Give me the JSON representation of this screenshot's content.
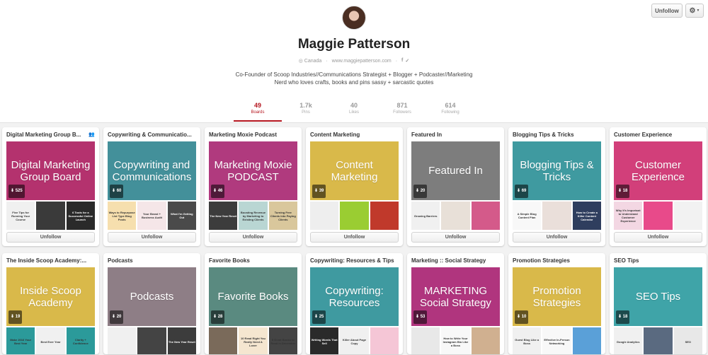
{
  "top_actions": {
    "unfollow_label": "Unfollow",
    "gear_icon": "gear-icon"
  },
  "profile": {
    "name": "Maggie Patterson",
    "location": "Canada",
    "website": "www.maggiepatterson.com",
    "bio_line1": "Co-Founder of Scoop Industries//Communications Strategist + Blogger + Podcaster//Marketing",
    "bio_line2": "Nerd who loves crafts, books and pins sassy + sarcastic quotes"
  },
  "stats": [
    {
      "num": "49",
      "label": "Boards",
      "active": true
    },
    {
      "num": "1.7k",
      "label": "Pins"
    },
    {
      "num": "40",
      "label": "Likes"
    },
    {
      "num": "871",
      "label": "Followers"
    },
    {
      "num": "614",
      "label": "Following"
    }
  ],
  "colors": {
    "accent": "#b5161f",
    "muted": "#999999"
  },
  "boards": [
    {
      "title": "Digital Marketing Group B...",
      "cover": "Digital Marketing Group Board",
      "pins": "525",
      "bg": "#b4326e",
      "button": "Unfollow",
      "collab": true,
      "thumbs": [
        {
          "t": "Five Tips for Running Your Course",
          "bg": "#f0f0f0"
        },
        {
          "t": "",
          "bg": "#3a3a3a"
        },
        {
          "t": "6 Tools for a Successful Online Launch",
          "bg": "#2a2a2a"
        }
      ]
    },
    {
      "title": "Copywriting & Communicatio...",
      "cover": "Copywriting and Communications",
      "pins": "60",
      "bg": "#43909a",
      "button": "Unfollow",
      "thumbs": [
        {
          "t": "Ways to Repurpose List Type Blog Posts",
          "bg": "#f6dfae"
        },
        {
          "t": "Your Brand + Business Audit",
          "bg": "#f5e6e8"
        },
        {
          "t": "What I'm Getting Out",
          "bg": "#4a4a4a"
        }
      ]
    },
    {
      "title": "Marketing Moxie Podcast",
      "cover": "Marketing Moxie PODCAST",
      "pins": "46",
      "bg": "#b03a7e",
      "button": "Unfollow",
      "thumbs": [
        {
          "t": "The New Year Reset",
          "bg": "#3c3c3c"
        },
        {
          "t": "Boosting Revenue by Marketing to Existing Clients",
          "bg": "#b9d6d3"
        },
        {
          "t": "Turning Free Clients into Paying Clients",
          "bg": "#d9c79c"
        }
      ]
    },
    {
      "title": "Content Marketing",
      "cover": "Content Marketing",
      "pins": "39",
      "bg": "#d9b94a",
      "button": "Unfollow",
      "thumbs": [
        {
          "t": "",
          "bg": "#eeeeee"
        },
        {
          "t": "",
          "bg": "#9acd32"
        },
        {
          "t": "",
          "bg": "#c0392b"
        }
      ]
    },
    {
      "title": "Featured In",
      "cover": "Featured In",
      "pins": "20",
      "bg": "#7d7d7d",
      "button": "Unfollow",
      "thumbs": [
        {
          "t": "Growing Barriers",
          "bg": "#f0f0f0"
        },
        {
          "t": "",
          "bg": "#e8e0d8"
        },
        {
          "t": "",
          "bg": "#d45a8a"
        }
      ]
    },
    {
      "title": "Blogging Tips & Tricks",
      "cover": "Blogging Tips & Tricks",
      "pins": "69",
      "bg": "#3f9aa0",
      "button": "Unfollow",
      "thumbs": [
        {
          "t": "A Simple Blog Content Plan",
          "bg": "#f8f8f8"
        },
        {
          "t": "",
          "bg": "#eadfda"
        },
        {
          "t": "How to Create a Killer Content Calendar",
          "bg": "#2f3e5e"
        }
      ]
    },
    {
      "title": "Customer Experience",
      "cover": "Customer Experience",
      "pins": "18",
      "bg": "#d23f7a",
      "button": "Unfollow",
      "thumbs": [
        {
          "t": "Why It's Important to Understand Customer Experience",
          "bg": "#f3d7e3"
        },
        {
          "t": "",
          "bg": "#e84a8a"
        },
        {
          "t": "",
          "bg": "#f2f2f2"
        }
      ]
    },
    {
      "title": "The Inside Scoop Academy:...",
      "cover": "Inside Scoop Academy",
      "pins": "19",
      "bg": "#d9b94a",
      "thumbs": [
        {
          "t": "Make 2016 Your Best Year",
          "bg": "#2b9a9a"
        },
        {
          "t": "Best Ever Year",
          "bg": "#f0f0f0"
        },
        {
          "t": "Clarity + Confidence",
          "bg": "#2b9a9a"
        }
      ]
    },
    {
      "title": "Podcasts",
      "cover": "Podcasts",
      "pins": "20",
      "bg": "#8e7e86",
      "thumbs": [
        {
          "t": "",
          "bg": "#f0f0f0"
        },
        {
          "t": "",
          "bg": "#444"
        },
        {
          "t": "The New Year Reset",
          "bg": "#3c3c3c"
        }
      ]
    },
    {
      "title": "Favorite Books",
      "cover": "Favorite Books",
      "pins": "28",
      "bg": "#5a8a80",
      "thumbs": [
        {
          "t": "",
          "bg": "#7a6a5a"
        },
        {
          "t": "10 Read Right You Really Need A Lover",
          "bg": "#f5e6d0"
        },
        {
          "t": "5 Great Books to Read in December",
          "bg": "#444"
        }
      ]
    },
    {
      "title": "Copywriting: Resources & Tips",
      "cover": "Copywriting: Resources",
      "pins": "25",
      "bg": "#3f9aa0",
      "thumbs": [
        {
          "t": "Writing Words That Sell",
          "bg": "#2a2a2a"
        },
        {
          "t": "Killer About Page Copy",
          "bg": "#f0f0f0"
        },
        {
          "t": "",
          "bg": "#f5c6d6"
        }
      ]
    },
    {
      "title": "Marketing :: Social Strategy",
      "cover": "MARKETING Social Strategy",
      "pins": "53",
      "bg": "#b0357e",
      "thumbs": [
        {
          "t": "",
          "bg": "#e8e8e8"
        },
        {
          "t": "How to Write Your Instagram Bio Like a Boss",
          "bg": "#f8f8f8"
        },
        {
          "t": "",
          "bg": "#d0b090"
        }
      ]
    },
    {
      "title": "Promotion Strategies",
      "cover": "Promotion Strategies",
      "pins": "10",
      "bg": "#d9b94a",
      "thumbs": [
        {
          "t": "Guest Blog Like a Boss",
          "bg": "#f0f0f0"
        },
        {
          "t": "Effective In-Person Networking",
          "bg": "#f8f8f8"
        },
        {
          "t": "",
          "bg": "#5aa0d8"
        }
      ]
    },
    {
      "title": "SEO Tips",
      "cover": "SEO Tips",
      "pins": "18",
      "bg": "#3fa4a8",
      "thumbs": [
        {
          "t": "Google Analytics",
          "bg": "#f0f0f0"
        },
        {
          "t": "",
          "bg": "#5a6a80"
        },
        {
          "t": "SEO",
          "bg": "#e8e8e8"
        }
      ]
    }
  ]
}
